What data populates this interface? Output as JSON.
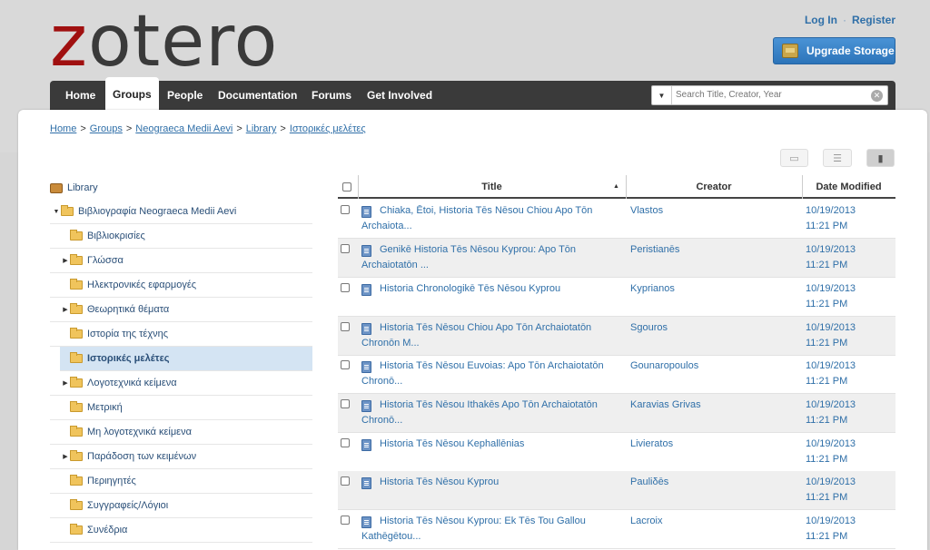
{
  "logo": {
    "first": "z",
    "rest": "otero"
  },
  "auth": {
    "login": "Log In",
    "separator": "·",
    "register": "Register"
  },
  "upgrade": {
    "label": "Upgrade Storage",
    "icon": "storage-box-icon"
  },
  "nav": {
    "items": [
      "Home",
      "Groups",
      "People",
      "Documentation",
      "Forums",
      "Get Involved"
    ],
    "active": "Groups",
    "search_placeholder": "Search Title, Creator, Year",
    "search_dropdown_icon": "caret-down-icon",
    "search_clear_icon": "clear-icon"
  },
  "breadcrumb": {
    "items": [
      "Home",
      "Groups",
      "Neograeca Medii Aevi",
      "Library",
      "Ιστορικές μελέτες"
    ],
    "separator": ">"
  },
  "toolbar": {
    "icons": [
      "new-item-icon",
      "list-view-icon",
      "settings-icon"
    ]
  },
  "library": {
    "title": "Library",
    "group": "Βιβλιογραφία Neograeca Medii Aevi",
    "collections": [
      {
        "name": "Βιβλιοκρισίες",
        "expandable": false
      },
      {
        "name": "Γλώσσα",
        "expandable": true
      },
      {
        "name": "Ηλεκτρονικές εφαρμογές",
        "expandable": false
      },
      {
        "name": "Θεωρητικά θέματα",
        "expandable": true
      },
      {
        "name": "Ιστορία της τέχνης",
        "expandable": false
      },
      {
        "name": "Ιστορικές μελέτες",
        "expandable": false,
        "selected": true
      },
      {
        "name": "Λογοτεχνικά κείμενα",
        "expandable": true
      },
      {
        "name": "Μετρική",
        "expandable": false
      },
      {
        "name": "Μη λογοτεχνικά κείμενα",
        "expandable": false
      },
      {
        "name": "Παράδοση των κειμένων",
        "expandable": true
      },
      {
        "name": "Περιηγητές",
        "expandable": false
      },
      {
        "name": "Συγγραφείς/Λόγιοι",
        "expandable": false
      },
      {
        "name": "Συνέδρια",
        "expandable": false
      }
    ]
  },
  "items_table": {
    "columns": [
      "Title",
      "Creator",
      "Date Modified"
    ],
    "sort_indicator": "▲",
    "rows": [
      {
        "title": "Chiaka, Ētoi, Historia Tēs Nēsou Chiou Apo Tōn Archaiota...",
        "creator": "Vlastos",
        "date": "10/19/2013",
        "time": "11:21 PM"
      },
      {
        "title": "Genikē Historia Tēs Nēsou Kyprou: Apo Tōn Archaiotatōn ...",
        "creator": "Peristianēs",
        "date": "10/19/2013",
        "time": "11:21 PM"
      },
      {
        "title": "Historia Chronologikē Tēs Nēsou Kyprou",
        "creator": "Kyprianos",
        "date": "10/19/2013",
        "time": "11:21 PM"
      },
      {
        "title": "Historia Tēs Nēsou Chiou Apo Tōn Archaiotatōn Chronōn M...",
        "creator": "Sgouros",
        "date": "10/19/2013",
        "time": "11:21 PM"
      },
      {
        "title": "Historia Tēs Nēsou Euvoias: Apo Tōn Archaiotatōn Chronō...",
        "creator": "Gounaropoulos",
        "date": "10/19/2013",
        "time": "11:21 PM"
      },
      {
        "title": "Historia Tēs Nēsou Ithakēs Apo Tōn Archaiotatōn Chronō...",
        "creator": "Karavias Grivas",
        "date": "10/19/2013",
        "time": "11:21 PM"
      },
      {
        "title": "Historia Tēs Nēsou Kephallēnias",
        "creator": "Livieratos",
        "date": "10/19/2013",
        "time": "11:21 PM"
      },
      {
        "title": "Historia Tēs Nēsou Kyprou",
        "creator": "Pauliδēs",
        "date": "10/19/2013",
        "time": "11:21 PM"
      },
      {
        "title": "Historia Tēs Nēsou Kyprou: Ek Tēs Tou Gallou Kathēgētou...",
        "creator": "Lacroix",
        "date": "10/19/2013",
        "time": "11:21 PM"
      }
    ]
  },
  "colors": {
    "link": "#2f6fa8",
    "nav_bg": "#3a3a3a",
    "logo_accent": "#a01010",
    "selected_row": "#d4e4f3",
    "button": "#2c74b9"
  }
}
